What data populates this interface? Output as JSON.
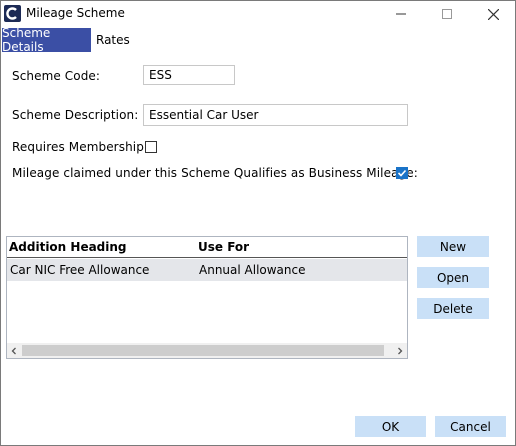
{
  "window": {
    "title": "Mileage Scheme"
  },
  "tabs": [
    {
      "label": "Scheme Details"
    },
    {
      "label": "Rates"
    }
  ],
  "form": {
    "scheme_code_label": "Scheme Code:",
    "scheme_code_value": "ESS",
    "scheme_description_label": "Scheme Description:",
    "scheme_description_value": "Essential Car User",
    "requires_membership_label": "Requires Membership:",
    "requires_membership_checked": false,
    "business_mileage_label": "Mileage claimed under this Scheme Qualifies as Business Mileage:",
    "business_mileage_checked": true
  },
  "grid": {
    "columns": [
      "Addition Heading",
      "Use For"
    ],
    "rows": [
      {
        "addition_heading": "Car NIC Free Allowance",
        "use_for": "Annual Allowance"
      }
    ]
  },
  "side_buttons": {
    "new": "New",
    "open": "Open",
    "delete": "Delete"
  },
  "footer_buttons": {
    "ok": "OK",
    "cancel": "Cancel"
  },
  "colors": {
    "active_tab": "#3b4fa5",
    "button": "#c9e0f7",
    "checkbox_checked": "#1a73c8",
    "selected_row": "#e4e6ea"
  }
}
